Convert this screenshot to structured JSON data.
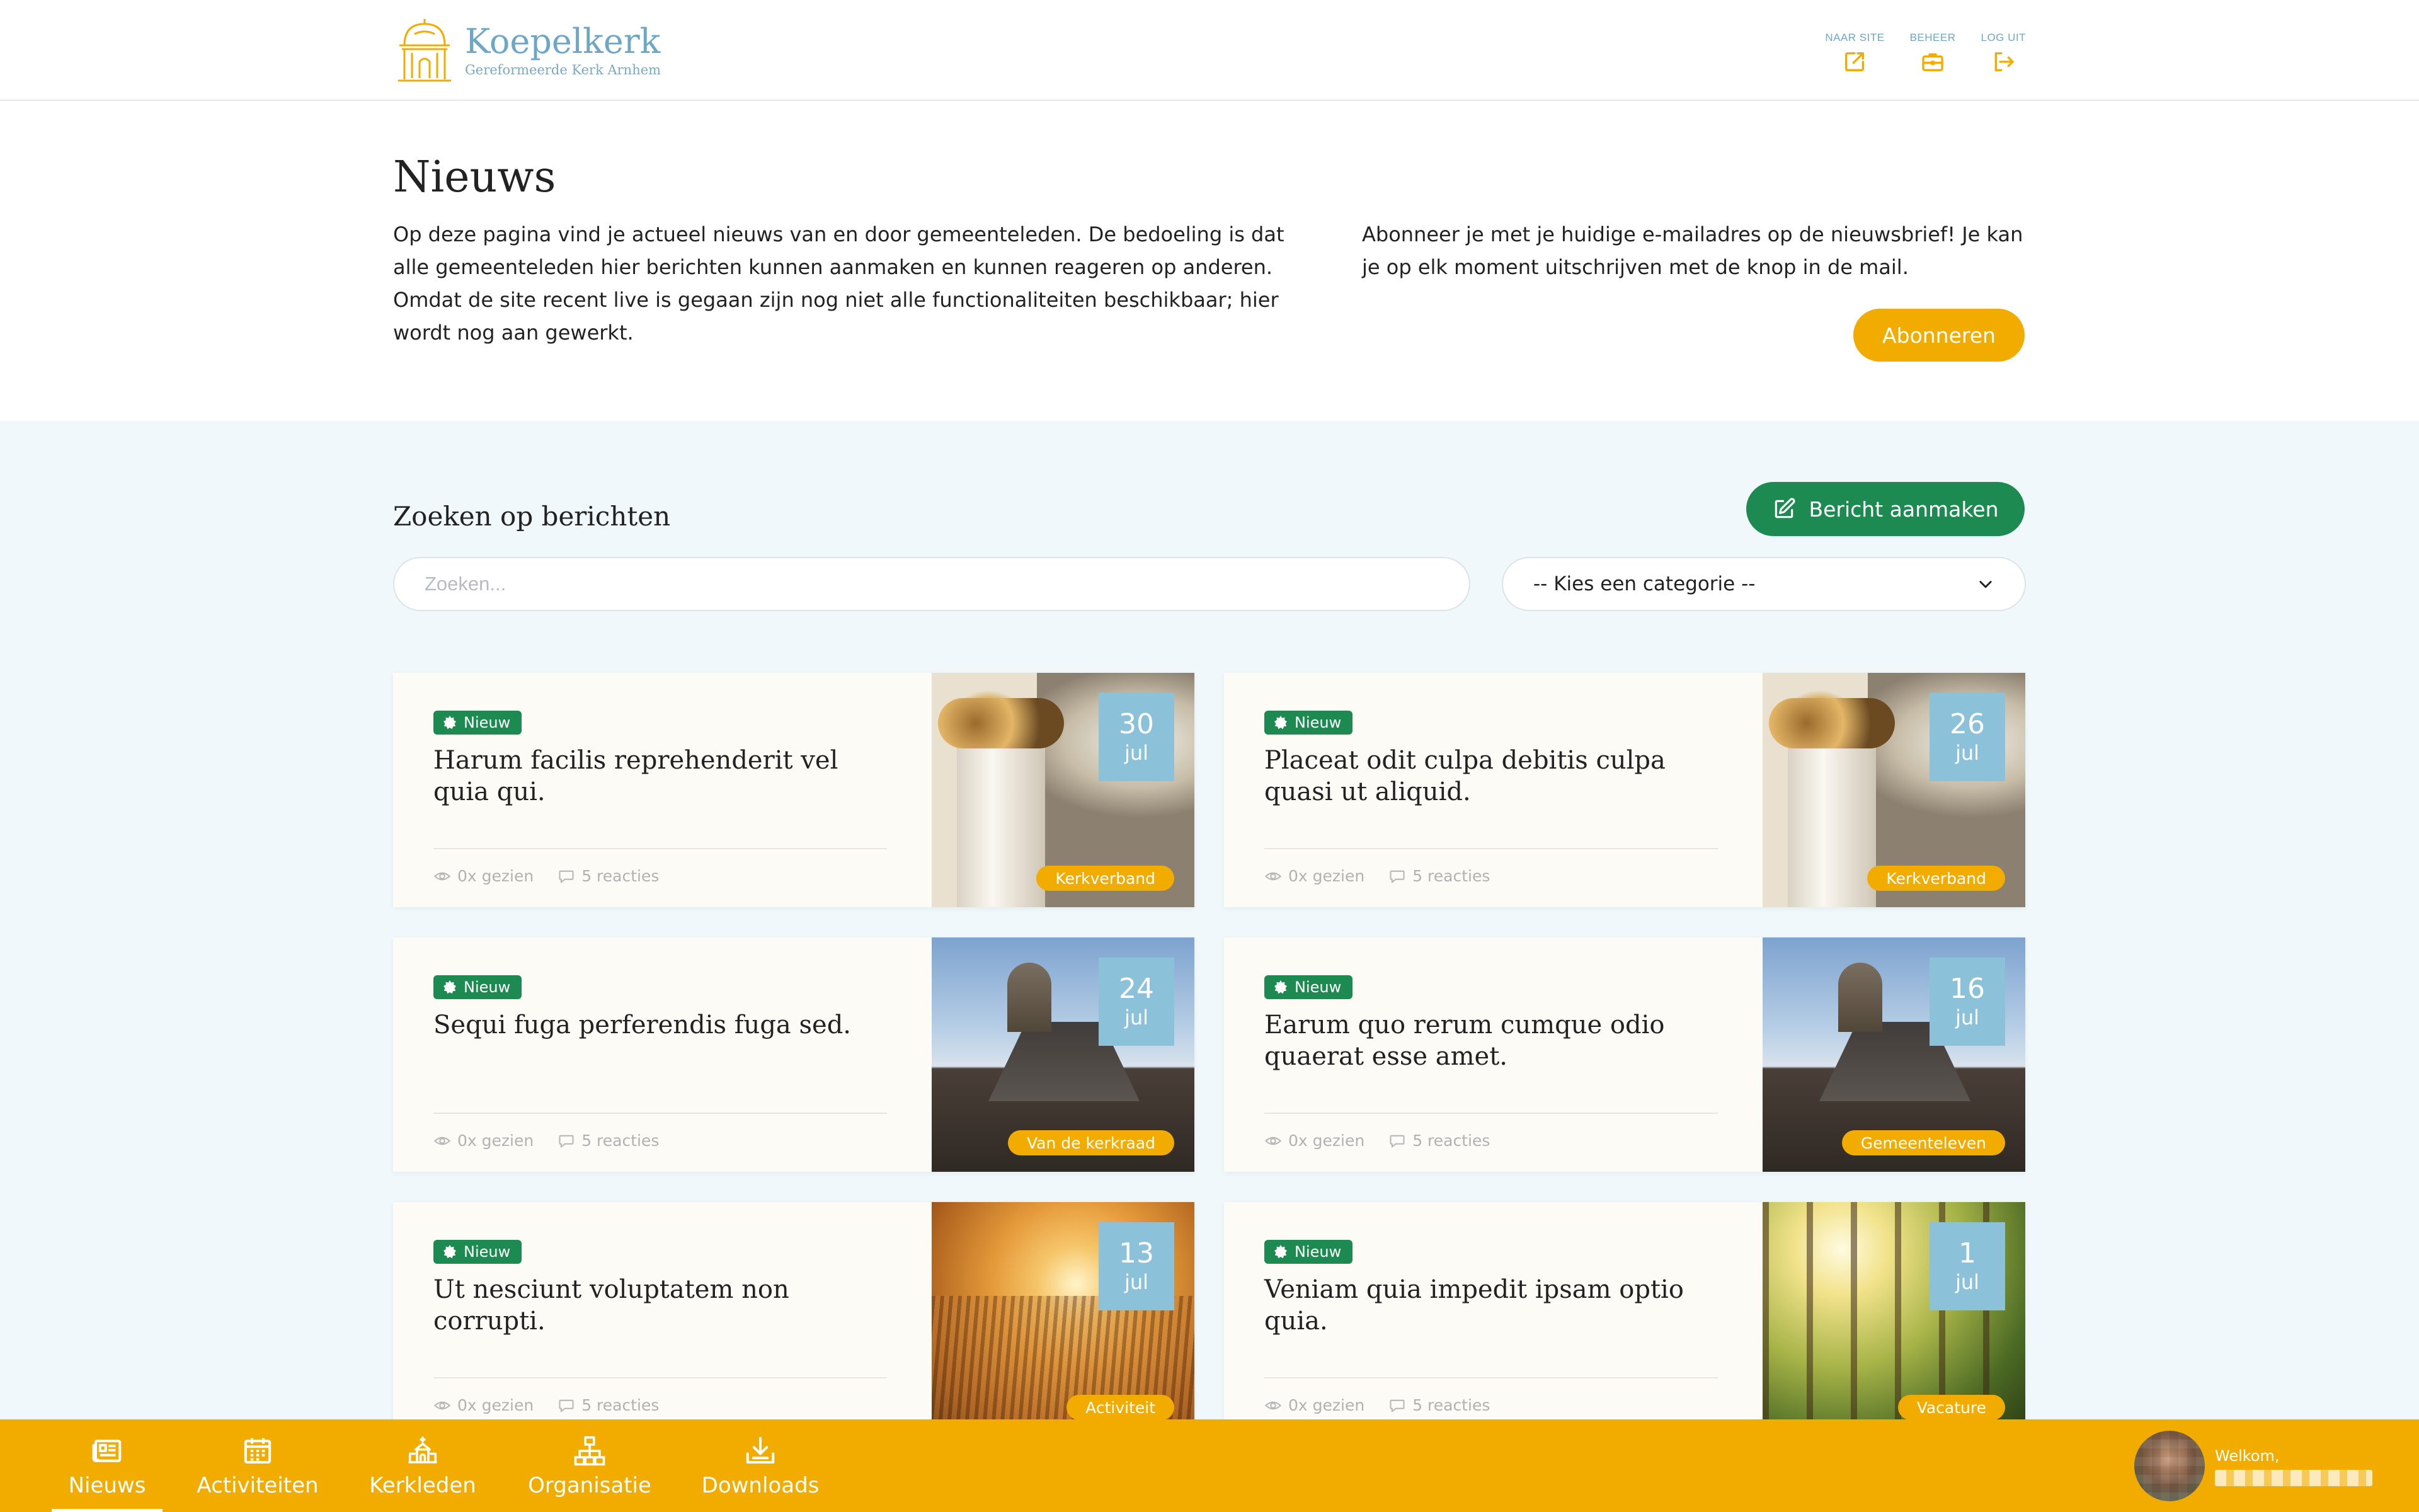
{
  "header": {
    "logo_title": "Koepelkerk",
    "logo_subtitle": "Gereformeerde Kerk Arnhem",
    "actions": [
      {
        "label": "NAAR SITE",
        "icon": "external-link-icon"
      },
      {
        "label": "BEHEER",
        "icon": "briefcase-icon"
      },
      {
        "label": "LOG UIT",
        "icon": "logout-icon"
      }
    ]
  },
  "intro": {
    "title": "Nieuws",
    "left_text": "Op deze pagina vind je actueel nieuws van en door gemeenteleden. De bedoeling is dat alle gemeenteleden hier berichten kunnen aanmaken en kunnen reageren op anderen. Omdat de site recent live is gegaan zijn nog niet alle functionaliteiten beschikbaar; hier wordt nog aan gewerkt.",
    "right_text": "Abonneer je met je huidige e-mailadres op de nieuwsbrief! Je kan je op elk moment uitschrijven met de knop in de mail.",
    "subscribe_label": "Abonneren"
  },
  "search": {
    "title": "Zoeken op berichten",
    "create_label": "Bericht aanmaken",
    "placeholder": "Zoeken...",
    "value": "",
    "category_selected": "-- Kies een categorie --"
  },
  "posts": [
    {
      "badge": "Nieuw",
      "title": "Harum facilis reprehenderit vel quia qui.",
      "views": "0x gezien",
      "reactions": "5 reacties",
      "day": "30",
      "month": "jul",
      "category": "Kerkverband",
      "image": "columns"
    },
    {
      "badge": "Nieuw",
      "title": "Placeat odit culpa debitis culpa quasi ut aliquid.",
      "views": "0x gezien",
      "reactions": "5 reacties",
      "day": "26",
      "month": "jul",
      "category": "Kerkverband",
      "image": "columns"
    },
    {
      "badge": "Nieuw",
      "title": "Sequi fuga perferendis fuga sed.",
      "views": "0x gezien",
      "reactions": "5 reacties",
      "day": "24",
      "month": "jul",
      "category": "Van de kerkraad",
      "image": "church"
    },
    {
      "badge": "Nieuw",
      "title": "Earum quo rerum cumque odio quaerat esse amet.",
      "views": "0x gezien",
      "reactions": "5 reacties",
      "day": "16",
      "month": "jul",
      "category": "Gemeenteleven",
      "image": "church"
    },
    {
      "badge": "Nieuw",
      "title": "Ut nesciunt voluptatem non corrupti.",
      "views": "0x gezien",
      "reactions": "5 reacties",
      "day": "13",
      "month": "jul",
      "category": "Activiteit",
      "image": "wheat"
    },
    {
      "badge": "Nieuw",
      "title": "Veniam quia impedit ipsam optio quia.",
      "views": "0x gezien",
      "reactions": "5 reacties",
      "day": "1",
      "month": "jul",
      "category": "Vacature",
      "image": "forest"
    }
  ],
  "bottom_nav": {
    "items": [
      {
        "label": "Nieuws",
        "icon": "newspaper-icon",
        "active": true
      },
      {
        "label": "Activiteiten",
        "icon": "calendar-icon",
        "active": false
      },
      {
        "label": "Kerkleden",
        "icon": "people-icon",
        "active": false
      },
      {
        "label": "Organisatie",
        "icon": "sitemap-icon",
        "active": false
      },
      {
        "label": "Downloads",
        "icon": "download-icon",
        "active": false
      }
    ],
    "welcome": "Welkom,"
  },
  "colors": {
    "accent_yellow": "#f2ac00",
    "accent_green": "#1d8b51",
    "logo_blue": "#6ea7c6",
    "date_blue": "#8cc1da",
    "bg_light": "#f0f8fb"
  }
}
